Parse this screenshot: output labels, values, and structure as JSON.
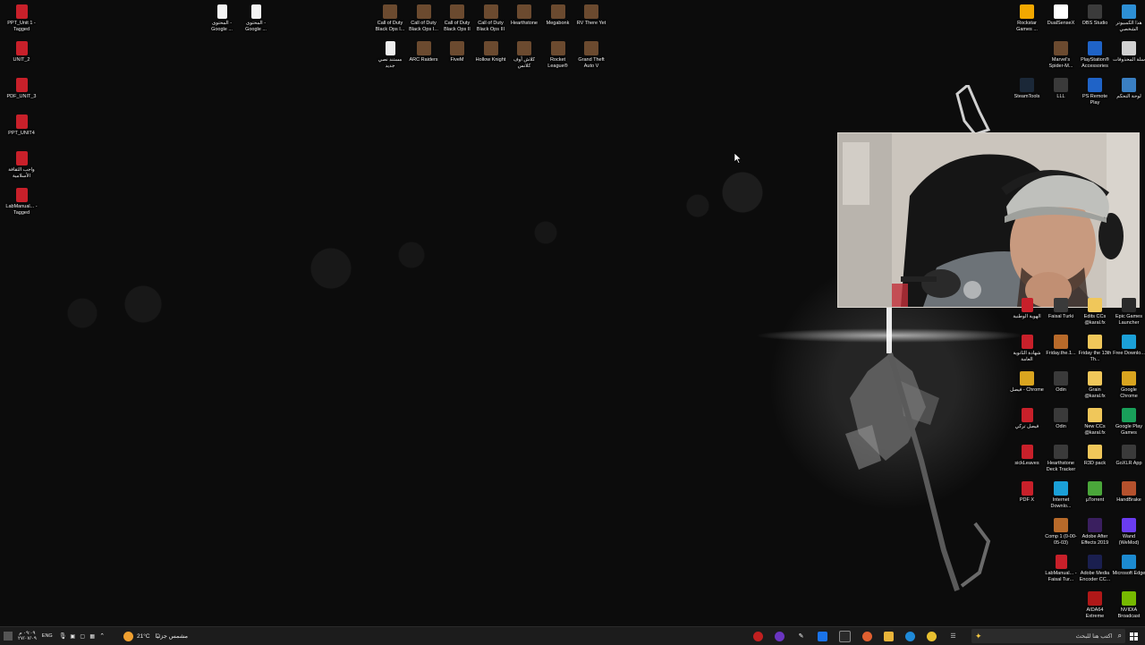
{
  "desktop": {
    "icons_left": [
      {
        "label": "PPT_Unit 1 - Tagged",
        "icon": "pdf-icon"
      },
      {
        "label": "UNIT_2",
        "icon": "pdf-icon"
      },
      {
        "label": "PDF_UNIT_3",
        "icon": "pdf-icon"
      },
      {
        "label": "PPT_UNIT4",
        "icon": "pdf-icon"
      },
      {
        "label": "واجب الثقافة الأسلامية",
        "icon": "pdf-icon"
      },
      {
        "label": "LabManual... - Tagged",
        "icon": "pdf-icon"
      }
    ],
    "icons_top_left": [
      {
        "label": "المحتوى - Google ...",
        "icon": "document-icon"
      },
      {
        "label": "المحتوى - Google ...",
        "icon": "document-icon"
      }
    ],
    "icons_top_row1": [
      {
        "label": "Call of Duty Black Ops I...",
        "icon": "game-icon"
      },
      {
        "label": "Call of Duty Black Ops I...",
        "icon": "game-icon"
      },
      {
        "label": "Call of Duty Black Ops II",
        "icon": "game-icon"
      },
      {
        "label": "Call of Duty Black Ops III",
        "icon": "game-icon"
      },
      {
        "label": "Hearthstone",
        "icon": "game-icon"
      },
      {
        "label": "Megabonk",
        "icon": "game-icon"
      },
      {
        "label": "RV There Yet",
        "icon": "game-icon"
      }
    ],
    "icons_top_row2": [
      {
        "label": "مستند نصي جديد",
        "icon": "text-file-icon"
      },
      {
        "label": "ARC Raiders",
        "icon": "game-icon"
      },
      {
        "label": "FiveM",
        "icon": "game-icon"
      },
      {
        "label": "Hollow Knight",
        "icon": "game-icon"
      },
      {
        "label": "كلاش أوف كلانس",
        "icon": "game-icon"
      },
      {
        "label": "Rocket League®",
        "icon": "game-icon"
      },
      {
        "label": "Grand Theft Auto V",
        "icon": "game-icon"
      }
    ],
    "icons_right_top": [
      {
        "label": "Rockstar Games ...",
        "icon": "rockstar-icon"
      },
      {
        "label": "DualSenseX",
        "icon": "controller-icon"
      },
      {
        "label": "OBS Studio",
        "icon": "obs-icon"
      },
      {
        "label": "هذا الكمبيوتر الشخصي",
        "icon": "computer-icon"
      },
      {
        "label": "Marvel's Spider-M...",
        "icon": "game-icon"
      },
      {
        "label": "PlayStation® Accessories",
        "icon": "playstation-icon"
      },
      {
        "label": "سلة المحذوفات",
        "icon": "recycle-bin-icon"
      },
      {
        "label": "SteamTools",
        "icon": "steam-icon"
      },
      {
        "label": "LLL",
        "icon": "app-icon"
      },
      {
        "label": "PS Remote Play",
        "icon": "playstation-icon"
      },
      {
        "label": "لوحة التحكم",
        "icon": "control-panel-icon"
      }
    ],
    "icons_right_bottom": [
      {
        "label": "الهوية الوطنية",
        "icon": "pdf-icon"
      },
      {
        "label": "Faisal Turki",
        "icon": "app-icon"
      },
      {
        "label": "Edits CCs @karal.fx",
        "icon": "folder-icon"
      },
      {
        "label": "Epic Games Launcher",
        "icon": "epic-icon"
      },
      {
        "label": "شهادة الثانوية العامة",
        "icon": "pdf-icon"
      },
      {
        "label": "Friday.the.1...",
        "icon": "video-icon"
      },
      {
        "label": "Friday the 13th Th...",
        "icon": "folder-icon"
      },
      {
        "label": "Free Downlo...",
        "icon": "download-icon"
      },
      {
        "label": "فيصل - Chrome",
        "icon": "chrome-icon"
      },
      {
        "label": "Odin",
        "icon": "app-icon"
      },
      {
        "label": "Grain @karal.fx",
        "icon": "folder-icon"
      },
      {
        "label": "Google Chrome",
        "icon": "chrome-icon"
      },
      {
        "label": "فيصل تركي",
        "icon": "pdf-icon"
      },
      {
        "label": "Odin",
        "icon": "app-icon"
      },
      {
        "label": "New CCs @karal.fx",
        "icon": "folder-icon"
      },
      {
        "label": "Google Play Games",
        "icon": "play-games-icon"
      },
      {
        "label": "sickLeaves",
        "icon": "pdf-icon"
      },
      {
        "label": "Hearthstone Deck Tracker",
        "icon": "app-icon"
      },
      {
        "label": "R3D pack",
        "icon": "folder-icon"
      },
      {
        "label": "GoXLR App",
        "icon": "app-icon"
      },
      {
        "label": "PDF X",
        "icon": "pdf-x-icon"
      },
      {
        "label": "Internet Downlo...",
        "icon": "download-icon"
      },
      {
        "label": "µTorrent",
        "icon": "torrent-icon"
      },
      {
        "label": "HandBrake",
        "icon": "handbrake-icon"
      },
      {
        "label": "",
        "icon": "empty"
      },
      {
        "label": "Comp 1 (0-00-05-03)",
        "icon": "video-icon"
      },
      {
        "label": "Adobe After Effects 2019",
        "icon": "after-effects-icon"
      },
      {
        "label": "Wand (WeMod)",
        "icon": "wemod-icon"
      },
      {
        "label": "",
        "icon": "empty"
      },
      {
        "label": "LabManual... - Faisal Tur...",
        "icon": "pdf-icon"
      },
      {
        "label": "Adobe Media Encoder CC...",
        "icon": "media-encoder-icon"
      },
      {
        "label": "Microsoft Edge",
        "icon": "edge-icon"
      },
      {
        "label": "",
        "icon": "empty"
      },
      {
        "label": "",
        "icon": "empty"
      },
      {
        "label": "AIDA64 Extreme",
        "icon": "aida-icon"
      },
      {
        "label": "NVIDIA Broadcast",
        "icon": "nvidia-icon"
      }
    ]
  },
  "taskbar": {
    "search_placeholder": "اكتب هنا للبحث",
    "weather_temp": "21°C",
    "weather_text": "مشمس جزئيًا",
    "language": "ENG",
    "time": "٠٩:٠٩ م",
    "date": "٢٧/٠٧/٠٩",
    "app_icons": [
      "start-icon",
      "task-view-icon",
      "edge-icon",
      "file-explorer-icon",
      "store-icon",
      "chrome-icon",
      "microsoft-edge-icon",
      "outlook-icon",
      "notepad-icon",
      "obs-icon",
      "record-icon"
    ]
  },
  "colors": {
    "pdf_red": "#c8202a",
    "taskbar_bg": "#1c1c1c",
    "desktop_bg": "#0c0c0c"
  }
}
